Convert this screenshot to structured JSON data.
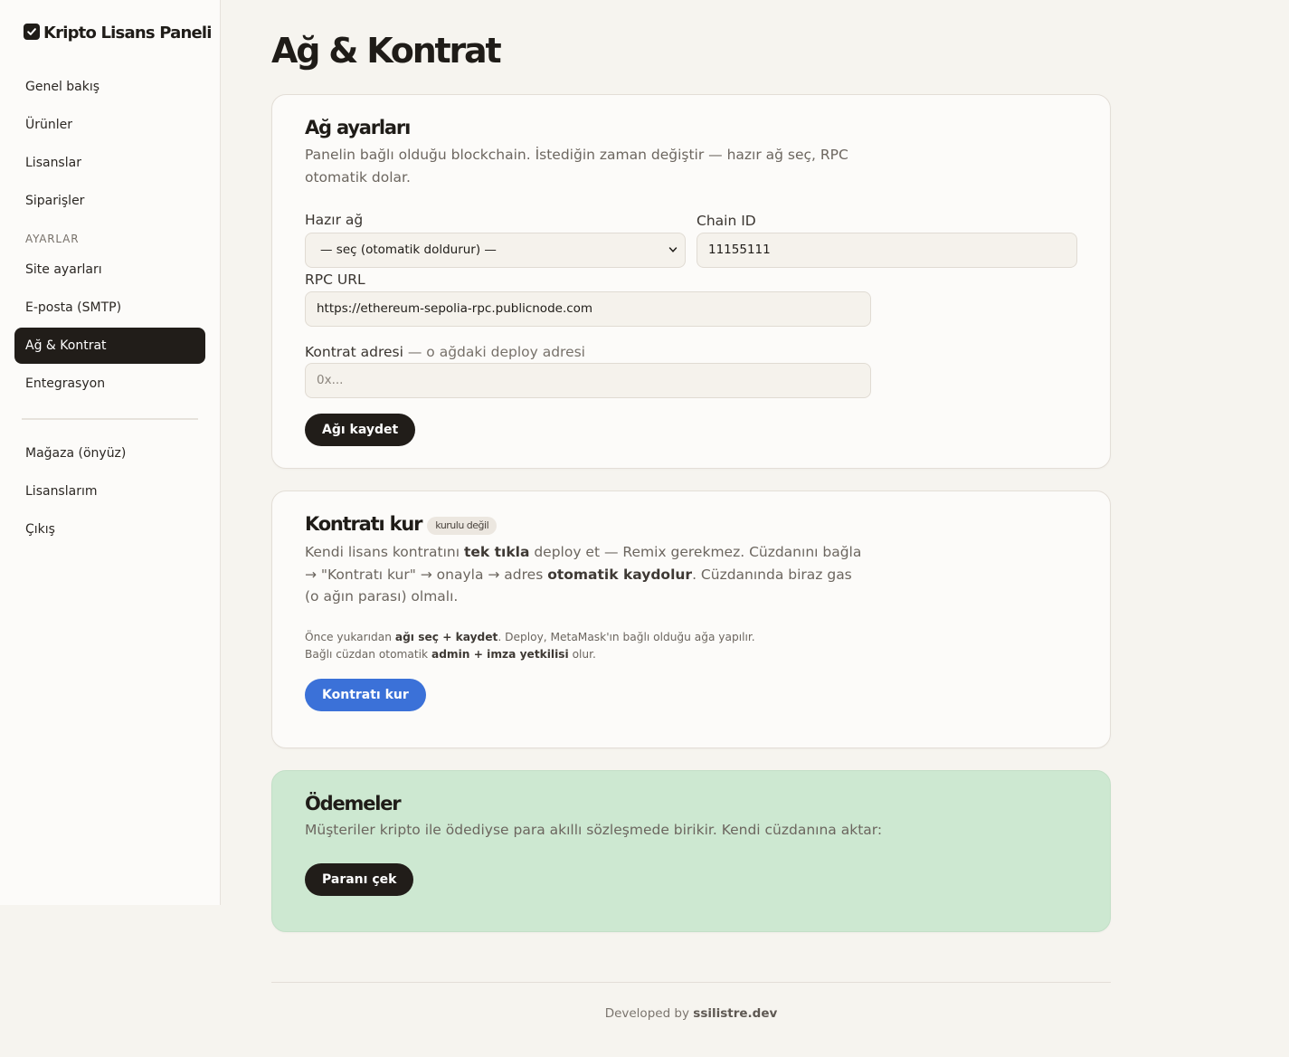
{
  "brand": {
    "title": "Kripto Lisans Paneli",
    "icon": "checkbox-icon"
  },
  "sidebar": {
    "items_top": [
      {
        "label": "Genel bakış"
      },
      {
        "label": "Ürünler"
      },
      {
        "label": "Lisanslar"
      },
      {
        "label": "Siparişler"
      }
    ],
    "section_label": "AYARLAR",
    "items_settings": [
      {
        "label": "Site ayarları"
      },
      {
        "label": "E-posta (SMTP)"
      },
      {
        "label": "Ağ & Kontrat",
        "active": true
      },
      {
        "label": "Entegrasyon"
      }
    ],
    "items_bottom": [
      {
        "label": "Mağaza (önyüz)"
      },
      {
        "label": "Lisanslarım"
      },
      {
        "label": "Çıkış"
      }
    ]
  },
  "page": {
    "title": "Ağ & Kontrat"
  },
  "network_card": {
    "title": "Ağ ayarları",
    "description": "Panelin bağlı olduğu blockchain. İstediğin zaman değiştir — hazır ağ seç, RPC otomatik dolar.",
    "preset_label": "Hazır ağ",
    "preset_value": "— seç (otomatik doldurur) —",
    "chain_id_label": "Chain ID",
    "chain_id_value": "11155111",
    "rpc_label": "RPC URL",
    "rpc_value": "https://ethereum-sepolia-rpc.publicnode.com",
    "contract_label": "Kontrat adresi",
    "contract_label_hint": " — o ağdaki deploy adresi",
    "contract_placeholder": "0x...",
    "save_button": "Ağı kaydet"
  },
  "deploy_card": {
    "title": "Kontratı kur",
    "badge": "kurulu değil",
    "desc_part1": "Kendi lisans kontratını ",
    "desc_bold1": "tek tıkla",
    "desc_part2": " deploy et — Remix gerekmez. Cüzdanını bağla → \"Kontratı kur\" → onayla → adres ",
    "desc_bold2": "otomatik kaydolur",
    "desc_part3": ". Cüzdanında biraz gas (o ağın parası) olmalı.",
    "note1_part1": "Önce yukarıdan ",
    "note1_bold": "ağı seç + kaydet",
    "note1_part2": ". Deploy, MetaMask'ın bağlı olduğu ağa yapılır.",
    "note2_part1": "Bağlı cüzdan otomatik ",
    "note2_bold": "admin + imza yetkilisi",
    "note2_part2": " olur.",
    "deploy_button": "Kontratı kur"
  },
  "payments_card": {
    "title": "Ödemeler",
    "description": "Müşteriler kripto ile ödediyse para akıllı sözleşmede birikir. Kendi cüzdanına aktar:",
    "withdraw_button": "Paranı çek"
  },
  "footer": {
    "prefix": "Developed by ",
    "author": "ssilistre.dev"
  },
  "colors": {
    "accent_dark": "#211d19",
    "accent_blue": "#3b71d8",
    "payments_bg": "#cde8d1",
    "page_bg": "#f6f4ef"
  }
}
